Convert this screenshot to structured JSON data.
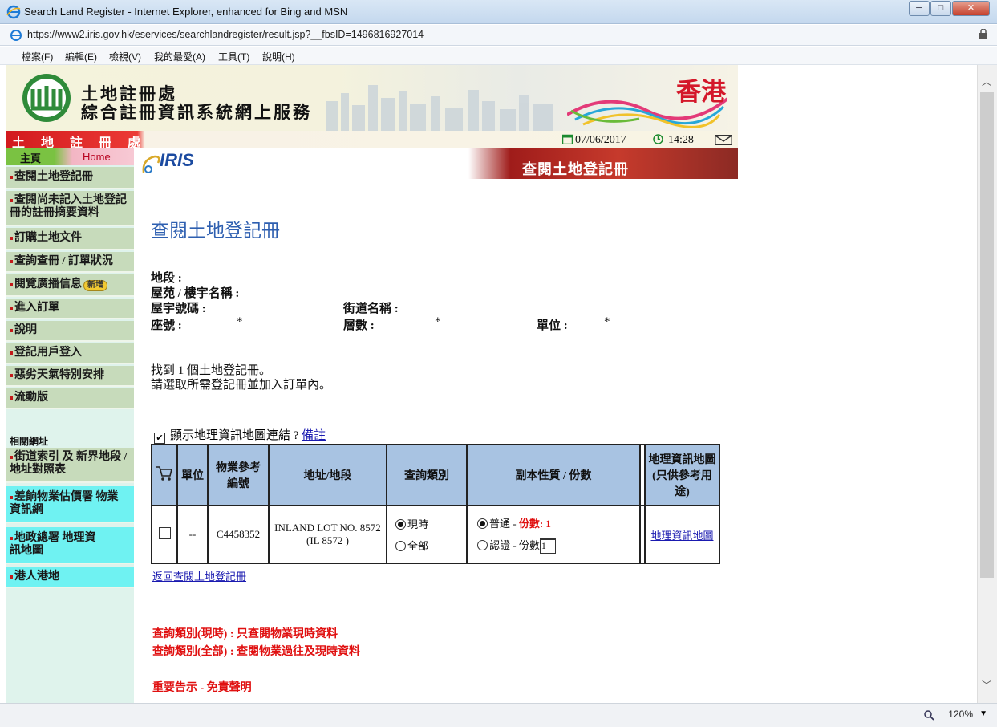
{
  "window": {
    "title": "Search Land Register - Internet Explorer, enhanced for Bing and MSN",
    "url": "https://www2.iris.gov.hk/eservices/searchlandregister/result.jsp?__fbsID=1496816927014",
    "minimize": "─",
    "restore": "□",
    "close": "✕"
  },
  "menu": [
    "檔案(F)",
    "編輯(E)",
    "檢視(V)",
    "我的最愛(A)",
    "工具(T)",
    "說明(H)"
  ],
  "status": {
    "zoom": "120%"
  },
  "header": {
    "line1": "土地註冊處",
    "line2": "綜合註冊資訊系統網上服務",
    "hk": "香港",
    "dept": "土 地 註 冊 處",
    "date": "07/06/2017",
    "time": "14:28"
  },
  "sidebar": {
    "home_zh": "主頁",
    "home_en": "Home",
    "items": [
      "查閱土地登記冊",
      "查閱尚未記入土地登記冊的註冊摘要資料",
      "訂購土地文件",
      "查詢查冊 / 訂單狀況",
      "閱覽廣播信息",
      "進入訂單",
      "說明",
      "登記用戶登入",
      "惡劣天氣特別安排",
      "流動版"
    ],
    "new_badge": "新增",
    "related_label": "相關網址",
    "related": [
      "街道索引 及 新界地段 / 地址對照表",
      "差餉物業估價署 物業資訊網",
      "地政總署 地理資訊地圖",
      "港人港地"
    ]
  },
  "banner": {
    "logo": "IRIS",
    "title": "查閱土地登記冊"
  },
  "main": {
    "title": "查閱土地登記冊",
    "lot_label": "地段 :",
    "estate_label": "屋苑 / 樓宇名稱 :",
    "building_no_label": "屋宇號碼 :",
    "street_label": "街道名稱 :",
    "block_label": "座號 :",
    "block_value": "*",
    "floor_label": "層數 :",
    "floor_value": "*",
    "unit_label": "單位 :",
    "unit_value": "*",
    "found_msg": "找到 1 個土地登記冊。",
    "select_msg": "請選取所需登記冊並加入訂單內。",
    "gis_checkbox_label": "顯示地理資訊地圖連結 ?",
    "remarks_link": "備註",
    "back_link": "返回查閱土地登記冊",
    "note1": "查詢類別(現時) :  只查閱物業現時資料",
    "note2": "查詢類別(全部) :  查閱物業過往及現時資料",
    "note3": "重要告示 - 免責聲明"
  },
  "table": {
    "headers": {
      "unit": "單位",
      "prn": "物業參考編號",
      "address": "地址/地段",
      "search_type": "查詢類別",
      "copy_type": "副本性質 / 份數",
      "gis": "地理資訊地圖 (只供參考用途)"
    },
    "row": {
      "unit": "--",
      "prn": "C4458352",
      "address_line1": "INLAND LOT NO. 8572",
      "address_line2": "(IL 8572 )",
      "type_current": "現時",
      "type_all": "全部",
      "copy_ordinary": "普通 -",
      "copy_ordinary_qty": "份數: 1",
      "copy_certified": "認證 - 份數",
      "copy_certified_qty": "1",
      "gis_link": "地理資訊地圖"
    }
  },
  "colors": {
    "title_blue": "#2e5fb0",
    "header_cell": "#a8c3e2",
    "nav_green": "#c7dbbb",
    "nav_cyan": "#6ff2f2",
    "notice_red": "#e01010"
  }
}
